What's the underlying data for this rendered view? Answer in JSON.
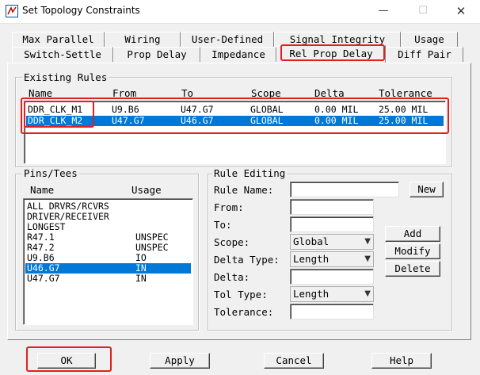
{
  "window": {
    "title": "Set Topology Constraints",
    "min_glyph": "—",
    "max_glyph": "☐",
    "close_glyph": "✕"
  },
  "tabs_row1": [
    "Max Parallel",
    "Wiring",
    "User-Defined",
    "Signal Integrity",
    "Usage"
  ],
  "tabs_row2": [
    "Switch-Settle",
    "Prop Delay",
    "Impedance",
    "Rel Prop Delay",
    "Diff Pair"
  ],
  "active_tab": "Rel Prop Delay",
  "existing_rules": {
    "label": "Existing Rules",
    "headers": [
      "Name",
      "From",
      "To",
      "Scope",
      "Delta",
      "Tolerance"
    ],
    "rows": [
      [
        "DDR_CLK_M1",
        "U9.B6",
        "U47.G7",
        "GLOBAL",
        "0.00 MIL",
        "25.00 MIL"
      ],
      [
        "DDR_CLK_M2",
        "U47.G7",
        "U46.G7",
        "GLOBAL",
        "0.00 MIL",
        "25.00 MIL"
      ]
    ],
    "selected_index": 1
  },
  "pins_tees": {
    "label": "Pins/Tees",
    "headers": [
      "Name",
      "Usage"
    ],
    "rows": [
      [
        "ALL DRVRS/RCVRS",
        ""
      ],
      [
        "DRIVER/RECEIVER",
        ""
      ],
      [
        "LONGEST",
        ""
      ],
      [
        "R47.1",
        "UNSPEC"
      ],
      [
        "R47.2",
        "UNSPEC"
      ],
      [
        "U9.B6",
        "IO"
      ],
      [
        "U46.G7",
        "IN"
      ],
      [
        "U47.G7",
        "IN"
      ]
    ],
    "selected_index": 6
  },
  "rule_editing": {
    "label": "Rule Editing",
    "rule_name_label": "Rule Name:",
    "rule_name_value": "",
    "from_label": "From:",
    "to_label": "To:",
    "scope_label": "Scope:",
    "scope_value": "Global",
    "delta_type_label": "Delta Type:",
    "delta_type_value": "Length",
    "delta_label": "Delta:",
    "tol_type_label": "Tol Type:",
    "tol_type_value": "Length",
    "tolerance_label": "Tolerance:",
    "new_btn": "New",
    "add_btn": "Add",
    "modify_btn": "Modify",
    "delete_btn": "Delete"
  },
  "footer": {
    "ok": "OK",
    "apply": "Apply",
    "cancel": "Cancel",
    "help": "Help"
  },
  "colors": {
    "selection": "#0078d7",
    "highlight_box": "#e02020"
  }
}
